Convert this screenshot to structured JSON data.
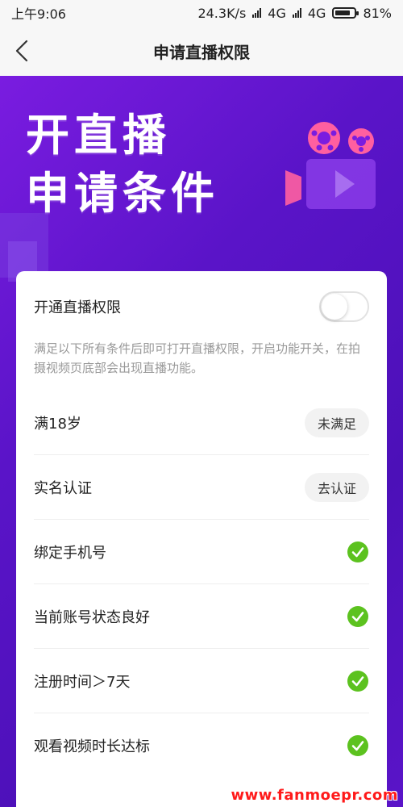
{
  "status_bar": {
    "time": "上午9:06",
    "network_speed": "24.3K/s",
    "network_1": "4G",
    "network_2": "4G",
    "battery": "81%",
    "battery_level": 0.81
  },
  "nav": {
    "title": "申请直播权限",
    "back_icon": "chevron-left-icon"
  },
  "banner": {
    "line1": "开直播",
    "line2": "申请条件",
    "icon": "movie-camera-icon",
    "colors": {
      "gradient_start": "#7a1ce0",
      "gradient_end": "#5a14c8"
    }
  },
  "card": {
    "toggle_label": "开通直播权限",
    "toggle_on": false,
    "description": "满足以下所有条件后即可打开直播权限，开启功能开关，在拍摄视频页底部会出现直播功能。",
    "conditions": [
      {
        "label": "满18岁",
        "status": "pill",
        "action": "未满足"
      },
      {
        "label": "实名认证",
        "status": "pill",
        "action": "去认证"
      },
      {
        "label": "绑定手机号",
        "status": "check"
      },
      {
        "label": "当前账号状态良好",
        "status": "check"
      },
      {
        "label": "注册时间＞7天",
        "status": "check"
      },
      {
        "label": "观看视频时长达标",
        "status": "check"
      }
    ],
    "colors": {
      "check_green": "#5cc21f",
      "pill_bg": "#f2f2f2"
    }
  },
  "watermark": "www.fanmoepr.com"
}
